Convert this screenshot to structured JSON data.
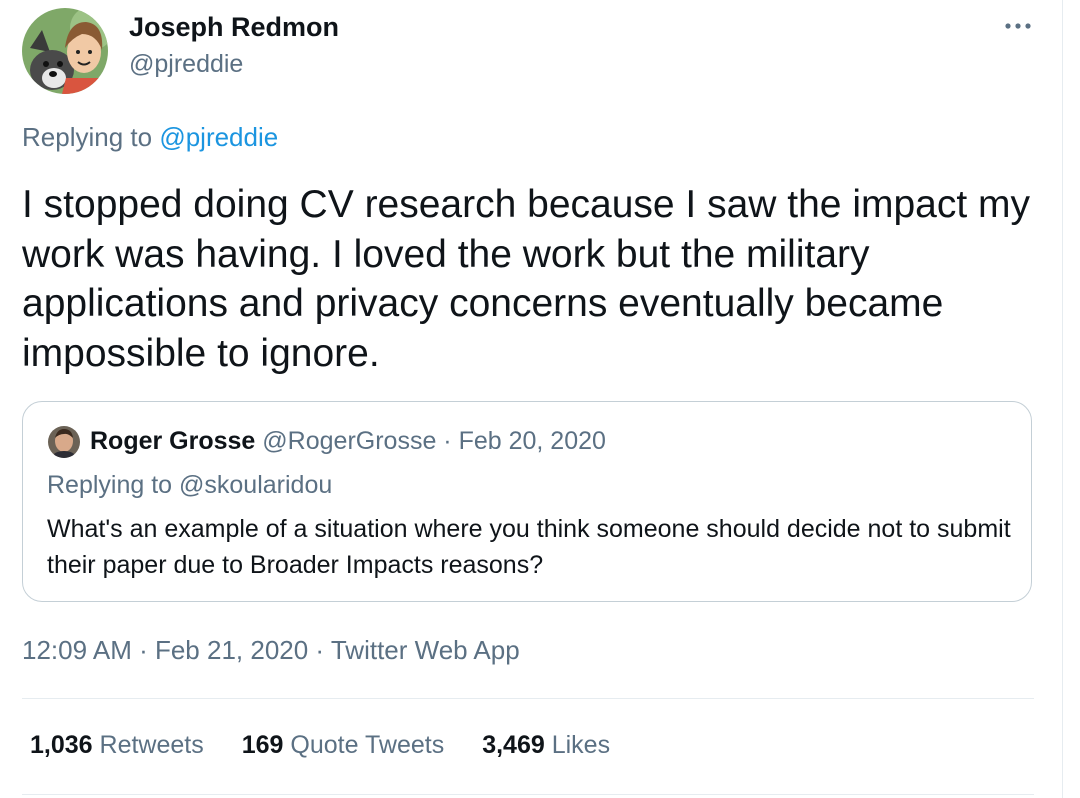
{
  "author": {
    "name": "Joseph Redmon",
    "handle": "@pjreddie"
  },
  "menu": {
    "icon": "more-horizontal-icon"
  },
  "reply_context": {
    "prefix": "Replying to ",
    "mention": "@pjreddie"
  },
  "tweet": {
    "text": "I stopped doing CV research because I saw the impact my work was having. I loved the work but the military applications and privacy concerns eventually became impossible to ignore."
  },
  "quote": {
    "name": "Roger Grosse",
    "handle": "@RogerGrosse",
    "separator": " · ",
    "date": "Feb 20, 2020",
    "replying": "Replying to @skoularidou",
    "text": "What's an example of a situation where you think someone should decide not to submit their paper due to Broader Impacts reasons?"
  },
  "meta": {
    "time": "12:09 AM",
    "sep1": " · ",
    "date": "Feb 21, 2020",
    "sep2": " · ",
    "source": "Twitter Web App"
  },
  "stats": {
    "retweets_count": "1,036",
    "retweets_label": "Retweets",
    "quotes_count": "169",
    "quotes_label": "Quote Tweets",
    "likes_count": "3,469",
    "likes_label": "Likes"
  },
  "colors": {
    "text": "#0f1419",
    "secondary": "#5b7083",
    "link": "#1b95e0",
    "border": "#c4cfd6"
  }
}
